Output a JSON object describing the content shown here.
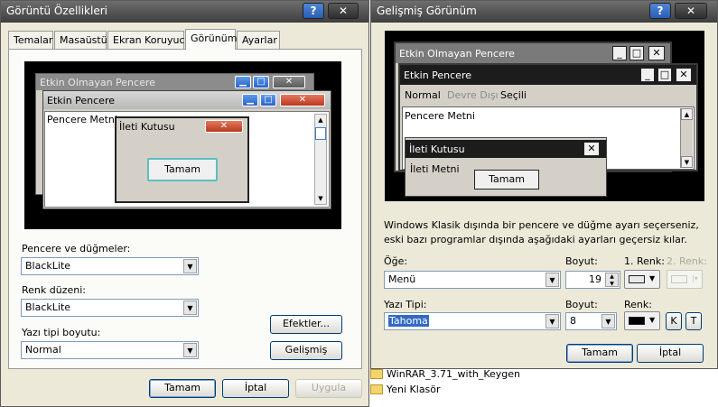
{
  "left_dialog": {
    "title": "Görüntü Özellikleri",
    "help_label": "?",
    "close_label": "✕",
    "tabs": [
      {
        "label": "Temalar"
      },
      {
        "label": "Masaüstü"
      },
      {
        "label": "Ekran Koruyucu"
      },
      {
        "label": "Görünüm"
      },
      {
        "label": "Ayarlar"
      }
    ],
    "preview": {
      "inactive_title": "Etkin Olmayan Pencere",
      "active_title": "Etkin Pencere",
      "window_text": "Pencere Metni",
      "message_title": "İleti Kutusu",
      "ok_label": "Tamam"
    },
    "windows_buttons_label": "Pencere ve düğmeler:",
    "windows_buttons_value": "BlackLite",
    "color_scheme_label": "Renk düzeni:",
    "color_scheme_value": "BlackLite",
    "font_size_label": "Yazı tipi boyutu:",
    "font_size_value": "Normal",
    "effects_button": "Efektler...",
    "advanced_button": "Gelişmiş",
    "ok_button": "Tamam",
    "cancel_button": "İptal",
    "apply_button": "Uygula"
  },
  "right_dialog": {
    "title": "Gelişmiş Görünüm",
    "help_label": "?",
    "close_label": "✕",
    "preview": {
      "inactive_title": "Etkin Olmayan Pencere",
      "active_title": "Etkin Pencere",
      "menu_normal": "Normal",
      "menu_disabled": "Devre Dışı",
      "menu_selected": "Seçili",
      "window_text": "Pencere Metni",
      "message_title": "İleti Kutusu",
      "message_text": "İleti Metni",
      "ok_label": "Tamam"
    },
    "info_text": "Windows Klasik dışında bir pencere ve düğme ayarı seçerseniz, eski bazı programlar dışında aşağıdaki ayarları geçersiz kılar.",
    "item_label": "Öğe:",
    "item_value": "Menü",
    "size_label": "Boyut:",
    "size_value": "19",
    "color1_label": "1. Renk:",
    "color2_label": "2. Renk:",
    "font_label": "Yazı Tipi:",
    "font_value": "Tahoma",
    "font_size_label": "Boyut:",
    "font_size_value": "8",
    "font_color_label": "Renk:",
    "bold_label": "K",
    "italic_label": "T",
    "ok_button": "Tamam",
    "cancel_button": "İptal"
  },
  "desktop": {
    "folder1": "WinRAR_3.71_with_Keygen",
    "folder2": "Yeni Klasör"
  },
  "colors": {
    "accent": "#316ac5",
    "dialog_bg": "#ece9d8",
    "preview_bg": "#000000"
  }
}
